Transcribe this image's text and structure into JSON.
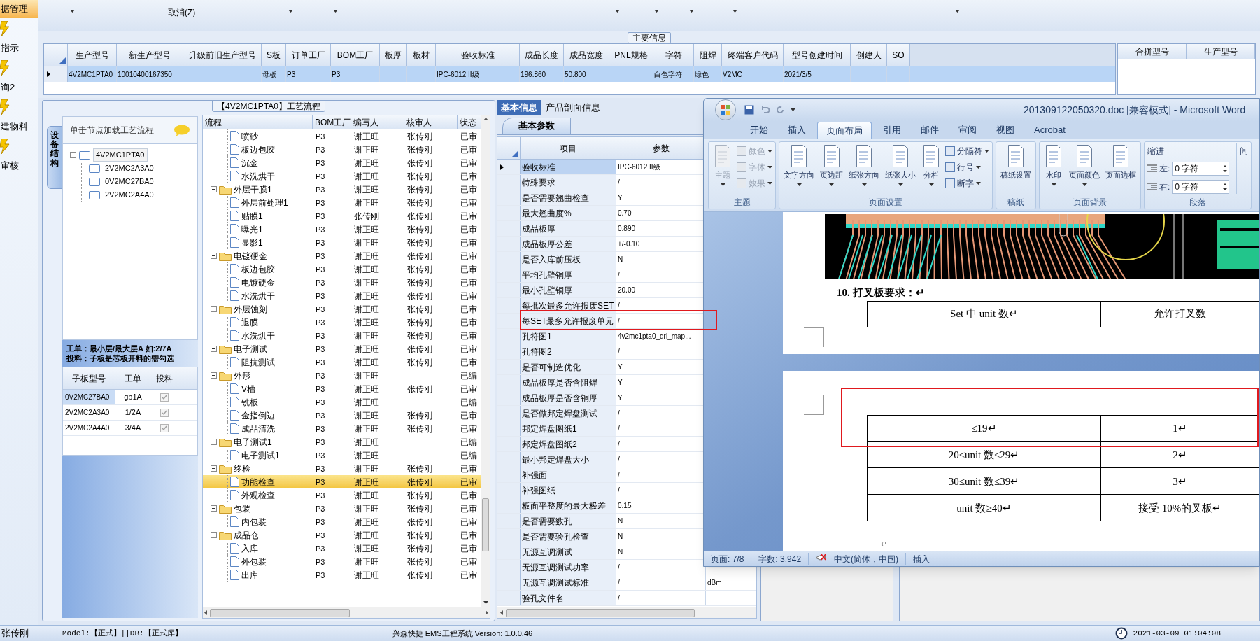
{
  "nav": {
    "items": [
      {
        "label": "据管理",
        "selected": true
      },
      {
        "label": "指示",
        "selected": false
      },
      {
        "label": "询2",
        "selected": false
      },
      {
        "label": "建物料",
        "selected": false
      },
      {
        "label": "审核",
        "selected": false
      }
    ]
  },
  "toolbar": {
    "cancel": "取消(Z)"
  },
  "main_info": {
    "title": "主要信息",
    "columns": [
      "生产型号",
      "新生产型号",
      "升级前旧生产型号",
      "S板",
      "订单工厂",
      "BOM工厂",
      "板厚",
      "板材",
      "验收标准",
      "成品长度",
      "成品宽度",
      "PNL规格",
      "字符",
      "阻焊",
      "终端客户代码",
      "型号创建时间",
      "创建人",
      "SO"
    ],
    "rows": [
      {
        "selected": true,
        "cells": [
          "4V2MC1PTA0",
          "10010400167350",
          null,
          "母板",
          "P3",
          "P3",
          null,
          null,
          "IPC-6012 II级",
          "196.860",
          "50.800",
          null,
          "白色字符",
          "绿色",
          "V2MC",
          "2021/3/5",
          null,
          null
        ]
      }
    ],
    "side_columns": [
      "合拼型号",
      "生产型号"
    ]
  },
  "process": {
    "title": "【4V2MC1PTA0】工艺流程",
    "side_tab": "设备结构",
    "hint": "单击节点加载工艺流程",
    "tree": [
      {
        "label": "4V2MC1PTA0",
        "expanded": true,
        "selected": true,
        "children": [
          {
            "label": "2V2MC2A3A0",
            "selected": false
          },
          {
            "label": "0V2MC27BA0",
            "selected": false
          },
          {
            "label": "2V2MC2A4A0",
            "selected": false
          }
        ]
      }
    ],
    "notes": [
      "工单：最小层/最大层A 如:2/7A",
      "投料：子板是芯板开料的需勾选"
    ],
    "sub_columns": [
      "子板型号",
      "工单",
      "投料"
    ],
    "sub_rows": [
      {
        "model": "0V2MC27BA0",
        "order": "gb1A",
        "checked": true,
        "selected": true
      },
      {
        "model": "2V2MC2A3A0",
        "order": "1/2A",
        "checked": true,
        "selected": false
      },
      {
        "model": "2V2MC2A4A0",
        "order": "3/4A",
        "checked": true,
        "selected": false
      }
    ],
    "columns": [
      "流程",
      "BOM工厂",
      "编写人",
      "核审人",
      "状态"
    ],
    "steps": [
      {
        "kind": "step",
        "name": "喷砂",
        "bom": "P3",
        "writer": "谢正旺",
        "reviewer": "张传刚",
        "status": "已审",
        "selected": false
      },
      {
        "kind": "step",
        "name": "板边包胶",
        "bom": "P3",
        "writer": "谢正旺",
        "reviewer": "张传刚",
        "status": "已审",
        "selected": false
      },
      {
        "kind": "step",
        "name": "沉金",
        "bom": "P3",
        "writer": "谢正旺",
        "reviewer": "张传刚",
        "status": "已审",
        "selected": false
      },
      {
        "kind": "step",
        "name": "水洗烘干",
        "bom": "P3",
        "writer": "谢正旺",
        "reviewer": "张传刚",
        "status": "已审",
        "selected": false
      },
      {
        "kind": "group",
        "name": "外层干膜1",
        "bom": "P3",
        "writer": "谢正旺",
        "reviewer": "张传刚",
        "status": "已审",
        "selected": false,
        "expanded": true,
        "children": [
          {
            "kind": "step",
            "name": "外层前处理1",
            "bom": "P3",
            "writer": "谢正旺",
            "reviewer": "张传刚",
            "status": "已审",
            "selected": false
          },
          {
            "kind": "step",
            "name": "贴膜1",
            "bom": "P3",
            "writer": "张传刚",
            "reviewer": "张传刚",
            "status": "已审",
            "selected": false
          },
          {
            "kind": "step",
            "name": "曝光1",
            "bom": "P3",
            "writer": "谢正旺",
            "reviewer": "张传刚",
            "status": "已审",
            "selected": false
          },
          {
            "kind": "step",
            "name": "显影1",
            "bom": "P3",
            "writer": "谢正旺",
            "reviewer": "张传刚",
            "status": "已审",
            "selected": false
          }
        ]
      },
      {
        "kind": "group",
        "name": "电镀硬金",
        "bom": "P3",
        "writer": "谢正旺",
        "reviewer": "张传刚",
        "status": "已审",
        "selected": false,
        "expanded": true,
        "children": [
          {
            "kind": "step",
            "name": "板边包胶",
            "bom": "P3",
            "writer": "谢正旺",
            "reviewer": "张传刚",
            "status": "已审",
            "selected": false
          },
          {
            "kind": "step",
            "name": "电镀硬金",
            "bom": "P3",
            "writer": "谢正旺",
            "reviewer": "张传刚",
            "status": "已审",
            "selected": false
          },
          {
            "kind": "step",
            "name": "水洗烘干",
            "bom": "P3",
            "writer": "谢正旺",
            "reviewer": "张传刚",
            "status": "已审",
            "selected": false
          }
        ]
      },
      {
        "kind": "group",
        "name": "外层蚀刻",
        "bom": "P3",
        "writer": "谢正旺",
        "reviewer": "张传刚",
        "status": "已审",
        "selected": false,
        "expanded": true,
        "children": [
          {
            "kind": "step",
            "name": "退膜",
            "bom": "P3",
            "writer": "谢正旺",
            "reviewer": "张传刚",
            "status": "已审",
            "selected": false
          },
          {
            "kind": "step",
            "name": "水洗烘干",
            "bom": "P3",
            "writer": "谢正旺",
            "reviewer": "张传刚",
            "status": "已审",
            "selected": false
          }
        ]
      },
      {
        "kind": "group",
        "name": "电子测试",
        "bom": "P3",
        "writer": "谢正旺",
        "reviewer": "张传刚",
        "status": "已审",
        "selected": false,
        "expanded": true,
        "children": [
          {
            "kind": "step",
            "name": "阻抗测试",
            "bom": "P3",
            "writer": "谢正旺",
            "reviewer": "张传刚",
            "status": "已审",
            "selected": false
          }
        ]
      },
      {
        "kind": "group",
        "name": "外形",
        "bom": "P3",
        "writer": "谢正旺",
        "status": "已编",
        "selected": false,
        "expanded": true,
        "children": [
          {
            "kind": "step",
            "name": "V槽",
            "bom": "P3",
            "writer": "谢正旺",
            "reviewer": "张传刚",
            "status": "已审",
            "selected": false
          },
          {
            "kind": "step",
            "name": "铣板",
            "bom": "P3",
            "writer": "谢正旺",
            "status": "已编",
            "selected": false
          },
          {
            "kind": "step",
            "name": "金指倒边",
            "bom": "P3",
            "writer": "谢正旺",
            "reviewer": "张传刚",
            "status": "已审",
            "selected": false
          },
          {
            "kind": "step",
            "name": "成品清洗",
            "bom": "P3",
            "writer": "谢正旺",
            "reviewer": "张传刚",
            "status": "已审",
            "selected": false
          }
        ]
      },
      {
        "kind": "group",
        "name": "电子测试1",
        "bom": "P3",
        "writer": "谢正旺",
        "status": "已编",
        "selected": false,
        "expanded": true,
        "children": [
          {
            "kind": "step",
            "name": "电子测试1",
            "bom": "P3",
            "writer": "谢正旺",
            "status": "已编",
            "selected": false
          }
        ]
      },
      {
        "kind": "group",
        "name": "终检",
        "bom": "P3",
        "writer": "谢正旺",
        "reviewer": "张传刚",
        "status": "已审",
        "selected": false,
        "expanded": true,
        "children": [
          {
            "kind": "step",
            "name": "功能检查",
            "bom": "P3",
            "writer": "谢正旺",
            "reviewer": "张传刚",
            "status": "已审",
            "selected": true
          },
          {
            "kind": "step",
            "name": "外观检查",
            "bom": "P3",
            "writer": "谢正旺",
            "reviewer": "张传刚",
            "status": "已审",
            "selected": false
          }
        ]
      },
      {
        "kind": "group",
        "name": "包装",
        "bom": "P3",
        "writer": "谢正旺",
        "reviewer": "张传刚",
        "status": "已审",
        "selected": false,
        "expanded": true,
        "children": [
          {
            "kind": "step",
            "name": "内包装",
            "bom": "P3",
            "writer": "谢正旺",
            "reviewer": "张传刚",
            "status": "已审",
            "selected": false
          }
        ]
      },
      {
        "kind": "group",
        "name": "成品仓",
        "bom": "P3",
        "writer": "谢正旺",
        "reviewer": "张传刚",
        "status": "已审",
        "selected": false,
        "expanded": true,
        "children": [
          {
            "kind": "step",
            "name": "入库",
            "bom": "P3",
            "writer": "谢正旺",
            "reviewer": "张传刚",
            "status": "已审",
            "selected": false
          },
          {
            "kind": "step",
            "name": "外包装",
            "bom": "P3",
            "writer": "谢正旺",
            "reviewer": "张传刚",
            "status": "已审",
            "selected": false
          },
          {
            "kind": "step",
            "name": "出库",
            "bom": "P3",
            "writer": "谢正旺",
            "reviewer": "张传刚",
            "status": "已审",
            "selected": false
          }
        ]
      }
    ]
  },
  "params": {
    "tabs": [
      {
        "label": "基本信息",
        "selected": true
      },
      {
        "label": "产品剖面信息",
        "selected": false
      }
    ],
    "subtab": "基本参数",
    "columns": [
      "项目",
      "参数"
    ],
    "rows": [
      {
        "item": "验收标准",
        "value": "IPC-6012 II级",
        "selected": true
      },
      {
        "item": "特殊要求",
        "value": "/",
        "selected": false
      },
      {
        "item": "是否需要翘曲检查",
        "value": "Y",
        "selected": false
      },
      {
        "item": "最大翘曲度%",
        "value": "0.70",
        "selected": false
      },
      {
        "item": "成品板厚",
        "value": "0.890",
        "selected": false
      },
      {
        "item": "成品板厚公差",
        "value": "+/-0.10",
        "selected": false
      },
      {
        "item": "是否入库前压板",
        "value": "N",
        "selected": false
      },
      {
        "item": "平均孔壁铜厚",
        "value": "/",
        "selected": false
      },
      {
        "item": "最小孔壁铜厚",
        "value": "20.00",
        "selected": false
      },
      {
        "item": "每批次最多允许报废SET",
        "value": "/",
        "selected": false
      },
      {
        "item": "每SET最多允许报废单元",
        "value": "/",
        "selected": false
      },
      {
        "item": "孔符图1",
        "value": "4v2mc1pta0_drl_map...",
        "selected": false
      },
      {
        "item": "孔符图2",
        "value": "/",
        "selected": false
      },
      {
        "item": "是否可制造优化",
        "value": "Y",
        "selected": false
      },
      {
        "item": "成品板厚是否含阻焊",
        "value": "Y",
        "selected": false
      },
      {
        "item": "成品板厚是否含铜厚",
        "value": "Y",
        "selected": false
      },
      {
        "item": "是否做邦定焊盘测试",
        "value": "/",
        "selected": false
      },
      {
        "item": "邦定焊盘图纸1",
        "value": "/",
        "selected": false
      },
      {
        "item": "邦定焊盘图纸2",
        "value": "/",
        "selected": false
      },
      {
        "item": "最小邦定焊盘大小",
        "value": "/",
        "selected": false
      },
      {
        "item": "补强面",
        "value": "/",
        "selected": false
      },
      {
        "item": "补强图纸",
        "value": "/",
        "selected": false
      },
      {
        "item": "板面平整度的最大极差",
        "value": "0.15",
        "selected": false
      },
      {
        "item": "是否需要数孔",
        "value": "N",
        "selected": false
      },
      {
        "item": "是否需要验孔检查",
        "value": "N",
        "selected": false
      },
      {
        "item": "无源互调测试",
        "value": "N",
        "selected": false
      },
      {
        "item": "无源互调测试功率",
        "value": "/",
        "selected": false
      },
      {
        "item": "无源互调测试标准",
        "value": "/",
        "unit": "dBm",
        "selected": false
      },
      {
        "item": "验孔文件名",
        "value": "/",
        "selected": false
      }
    ]
  },
  "word": {
    "title": "201309122050320.doc [兼容模式] - Microsoft Word",
    "tabs": [
      {
        "label": "开始",
        "selected": false
      },
      {
        "label": "插入",
        "selected": false
      },
      {
        "label": "页面布局",
        "selected": true
      },
      {
        "label": "引用",
        "selected": false
      },
      {
        "label": "邮件",
        "selected": false
      },
      {
        "label": "审阅",
        "selected": false
      },
      {
        "label": "视图",
        "selected": false
      },
      {
        "label": "Acrobat",
        "selected": false
      }
    ],
    "ribbon": [
      {
        "label": "主题",
        "items": [
          {
            "kind": "large",
            "label": "主题",
            "disabled": true,
            "dropdown": true
          },
          {
            "kind": "small",
            "label": "颜色",
            "disabled": true,
            "dropdown": true
          },
          {
            "kind": "small",
            "label": "字体",
            "disabled": true,
            "dropdown": true
          },
          {
            "kind": "small",
            "label": "效果",
            "disabled": true,
            "dropdown": true
          }
        ]
      },
      {
        "label": "页面设置",
        "items": [
          {
            "kind": "large",
            "label": "文字方向",
            "disabled": false,
            "dropdown": true
          },
          {
            "kind": "large",
            "label": "页边距",
            "disabled": false,
            "dropdown": true
          },
          {
            "kind": "large",
            "label": "纸张方向",
            "disabled": false,
            "dropdown": true
          },
          {
            "kind": "large",
            "label": "纸张大小",
            "disabled": false,
            "dropdown": true
          },
          {
            "kind": "large",
            "label": "分栏",
            "disabled": false,
            "dropdown": true
          },
          {
            "kind": "small",
            "label": "分隔符",
            "disabled": false,
            "dropdown": true
          },
          {
            "kind": "small",
            "label": "行号",
            "disabled": false,
            "dropdown": true
          },
          {
            "kind": "small",
            "label": "断字",
            "disabled": false,
            "dropdown": true
          }
        ]
      },
      {
        "label": "稿纸",
        "items": [
          {
            "kind": "large",
            "label": "稿纸设置",
            "disabled": false,
            "dropdown": false
          }
        ]
      },
      {
        "label": "页面背景",
        "items": [
          {
            "kind": "large",
            "label": "水印",
            "disabled": false,
            "dropdown": true
          },
          {
            "kind": "large",
            "label": "页面颜色",
            "disabled": false,
            "dropdown": true
          },
          {
            "kind": "large",
            "label": "页面边框",
            "disabled": false,
            "dropdown": false
          }
        ]
      },
      {
        "label": "段落",
        "items": [
          {
            "kind": "heading",
            "label": "缩进",
            "disabled": false
          },
          {
            "kind": "spin",
            "label": "左:",
            "value": "0 字符",
            "disabled": false
          },
          {
            "kind": "spin",
            "label": "右:",
            "value": "0 字符",
            "disabled": false
          },
          {
            "kind": "heading",
            "label": "间",
            "disabled": false
          }
        ]
      }
    ],
    "heading": "10. 打叉板要求：↵",
    "table1": [
      [
        "Set 中 unit 数↵",
        "允许打叉数"
      ]
    ],
    "table2": [
      [
        "≤19↵",
        "1↵"
      ],
      [
        "20≤unit 数≤29↵",
        "2↵"
      ],
      [
        "30≤unit 数≤39↵",
        "3↵"
      ],
      [
        "unit 数≥40↵",
        "接受 10%的叉板↵"
      ]
    ],
    "end_mark": "↵",
    "status": [
      "页面: 7/8",
      "字数: 3,942",
      "中文(简体，中国)",
      "插入"
    ]
  },
  "status_bar": {
    "user": "张传刚",
    "model": "Model:【正式】||DB:【正式库】",
    "app": "兴森快捷 EMS工程系统 Version: 1.0.0.46",
    "time": "2021-03-09 01:04:08"
  }
}
